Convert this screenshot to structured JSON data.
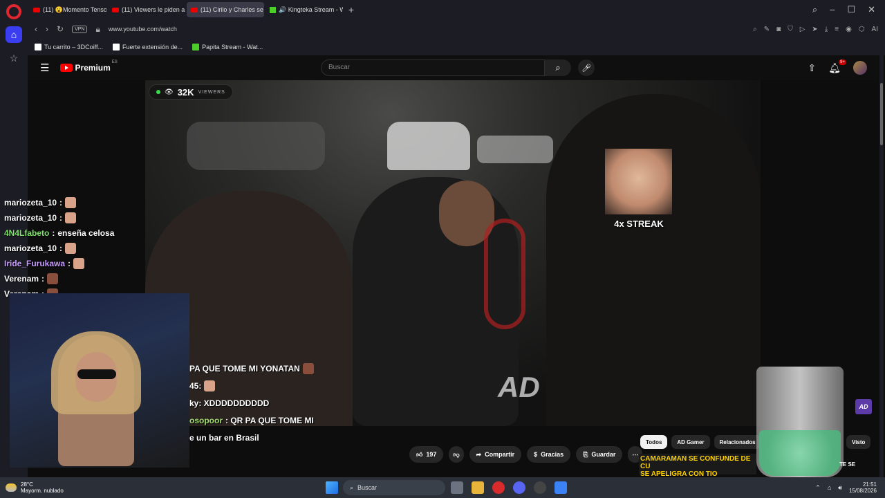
{
  "browser": {
    "tabs": [
      {
        "label": "(11) 😮Momento Tenso E"
      },
      {
        "label": "(11) Viewers le piden a Ki"
      },
      {
        "label": "(11) Cirilo y Charles se"
      },
      {
        "label": "🔊 Kingteka Stream - Wa"
      }
    ],
    "url": "www.youtube.com/watch",
    "vpn_label": "VPN",
    "bookmarks": [
      {
        "label": "Tu carrito – 3DCoiff..."
      },
      {
        "label": "Fuerte extensión de..."
      },
      {
        "label": "Papita Stream - Wat..."
      }
    ]
  },
  "youtube": {
    "brand": "Premium",
    "country": "ES",
    "search_placeholder": "Buscar",
    "notif_count": "9+"
  },
  "stream": {
    "viewers_count": "32K",
    "viewers_label": "VIEWERS",
    "streak_label": "4x STREAK",
    "watermark": "AD"
  },
  "chat": [
    {
      "user": "mariozeta_10",
      "text": "",
      "color": "#ffffff"
    },
    {
      "user": "mariozeta_10",
      "text": "",
      "color": "#ffffff"
    },
    {
      "user": "4N4Lfabeto",
      "text": "enseña celosa",
      "color": "#7fe36b"
    },
    {
      "user": "mariozeta_10",
      "text": "",
      "color": "#ffffff"
    },
    {
      "user": "Iride_Furukawa",
      "text": "",
      "color": "#c79bff"
    },
    {
      "user": "Verenam",
      "text": "",
      "color": "#ffffff"
    },
    {
      "user": "Verenam",
      "text": "",
      "color": "#ffffff"
    }
  ],
  "chat2": [
    {
      "name": "",
      "text": "PA QUE TOME MI YONATAN"
    },
    {
      "name": "",
      "text": "45:"
    },
    {
      "name": "",
      "text": "ky: XDDDDDDDDDD"
    },
    {
      "name": "osopoor",
      "text": ": QR PA QUE TOME MI"
    },
    {
      "name": "",
      "text": "e un bar en Brasil"
    }
  ],
  "actions": {
    "likes": "197",
    "share": "Compartir",
    "thanks": "Gracias",
    "save": "Guardar"
  },
  "chips": [
    "Todos",
    "AD Gamer",
    "Relacionados"
  ],
  "chip_right": "Visto",
  "ad_thumb": {
    "line1": "CAMARAMAN SE CONFUNDE DE CU",
    "line2": "SE APELIGRA CON TIO"
  },
  "thumb_right": "TE SE",
  "ad_badge": "AD",
  "taskbar": {
    "temp": "28°C",
    "weather": "Mayorm. nublado",
    "search": "Buscar",
    "time": "21:51",
    "date": "15/08/2026"
  }
}
